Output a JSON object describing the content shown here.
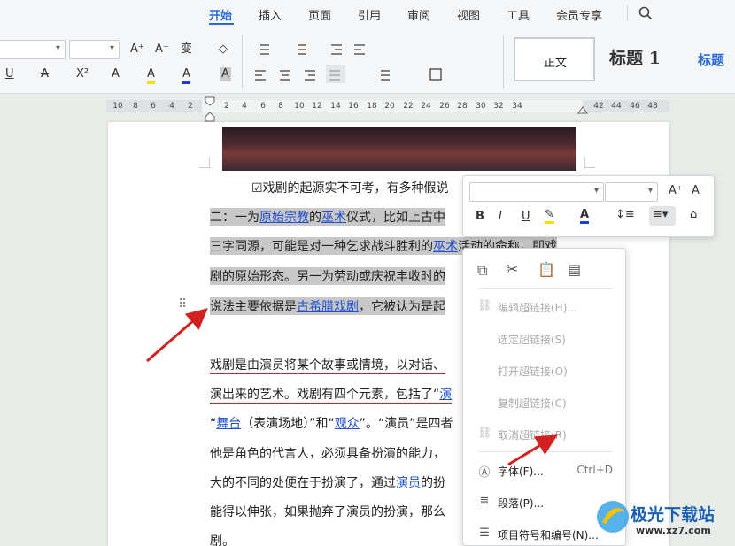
{
  "menu": {
    "tabs": [
      {
        "label": "开始",
        "active": true
      },
      {
        "label": "插入"
      },
      {
        "label": "页面"
      },
      {
        "label": "引用"
      },
      {
        "label": "审阅"
      },
      {
        "label": "视图"
      },
      {
        "label": "工具"
      },
      {
        "label": "会员专享"
      }
    ]
  },
  "ribbon": {
    "font_increase": "A⁺",
    "font_decrease": "A⁻",
    "phonetic": "变",
    "clear": "◇",
    "underline": "U",
    "strike": "A",
    "superscript": "X²",
    "effects": "A",
    "highlight": "A",
    "font_color": "A",
    "char_shading": "A",
    "styles": {
      "normal": "正文",
      "heading1": "标题 1",
      "heading": "标题"
    }
  },
  "ruler": {
    "left_numbers": [
      "10",
      "8",
      "6",
      "4",
      "2"
    ],
    "right_numbers": [
      "2",
      "4",
      "6",
      "8",
      "10",
      "12",
      "14",
      "16",
      "18",
      "20",
      "22",
      "24",
      "26",
      "28",
      "30",
      "32",
      "34"
    ],
    "far_numbers": [
      "42",
      "44",
      "46",
      "48"
    ]
  },
  "document": {
    "caption": "☑戏剧的起源实不可考，有多种假说",
    "p1_line1_a": "二：一为",
    "p1_link1": "原始宗教",
    "p1_line1_b": "的",
    "p1_link2": "巫术",
    "p1_line1_c": "仪式，比如上古中",
    "p1_line2_a": "三字同源，可能是对一种乞求战斗胜利的",
    "p1_link3": "巫术",
    "p1_line2_b": "活动的命称，即戏",
    "p1_line3": "剧的原始形态。另一为劳动或庆祝丰收时的",
    "p1_line4_a": "说法主要依据是",
    "p1_link4": "古希腊戏剧",
    "p1_line4_b": "，它被认为是起",
    "p2_line1": "戏剧是由演员将某个故事或情境，以对话、",
    "p2_line2_a": "演出来的艺术。戏剧有四个元素，包括了“",
    "p2_line2_link": "演",
    "p2_line3_a": "“",
    "p2_line3_link1": "舞台",
    "p2_line3_b": "（表演场地）”和“",
    "p2_line3_link2": "观众",
    "p2_line3_c": "”。“演员”是四者",
    "p2_line4": "他是角色的代言人，必须具备扮演的能力，",
    "p2_line5_a": "大的不同的处便在于扮演了，通过",
    "p2_line5_link": "演员",
    "p2_line5_b": "的扮",
    "p2_line6": "能得以伸张，如果抛弃了演员的扮演，那么",
    "p2_line7": "剧。"
  },
  "mini_toolbar": {
    "bold": "B",
    "italic": "I",
    "underline": "U"
  },
  "context_menu": {
    "items": [
      {
        "label": "编辑超链接(H)...",
        "disabled": true,
        "icon": "link-icon"
      },
      {
        "label": "选定超链接(S)",
        "disabled": true
      },
      {
        "label": "打开超链接(O)",
        "disabled": true
      },
      {
        "label": "复制超链接(C)",
        "disabled": true
      },
      {
        "label": "取消超链接(R)",
        "disabled": true,
        "icon": "unlink-icon"
      },
      {
        "label": "字体(F)...",
        "shortcut": "Ctrl+D",
        "icon": "font-icon"
      },
      {
        "label": "段落(P)...",
        "icon": "paragraph-icon"
      },
      {
        "label": "项目符号和编号(N)...",
        "icon": "list-icon"
      }
    ]
  },
  "watermark": {
    "text": "极光下载站",
    "url": "www.xz7.com"
  },
  "colors": {
    "accent": "#2a6ad8",
    "link": "#1f4fd0",
    "highlight": "#c8c8c8",
    "arrow": "#d32020"
  }
}
